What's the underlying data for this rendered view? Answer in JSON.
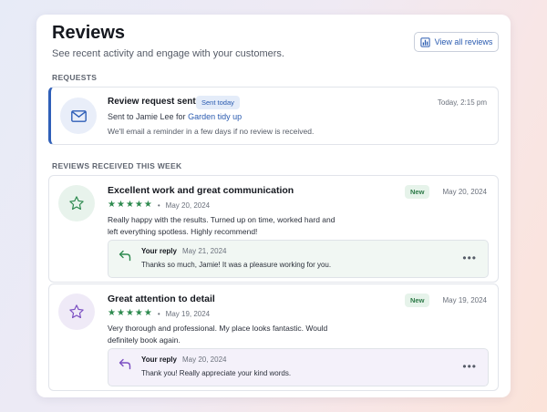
{
  "header": {
    "title": "Reviews",
    "subtitle": "See recent activity and engage with your customers.",
    "view_all_label": "View all reviews",
    "view_all_icon": "bar-chart-icon"
  },
  "requests": {
    "section_label": "REQUESTS",
    "item": {
      "icon": "mail-icon",
      "title": "Review request sent",
      "badge": "Sent today",
      "sent_to_prefix": "Sent to Jamie Lee for",
      "project_link": "Garden tidy up",
      "note": "We'll email a reminder in a few days if no review is received.",
      "time": "Today, 2:15 pm"
    }
  },
  "reviews": {
    "section_label": "REVIEWS RECEIVED THIS WEEK",
    "items": [
      {
        "icon": "star-outline-icon",
        "accent": "#2e8a4f",
        "title": "Excellent work and great communication",
        "rating": 5,
        "review_date": "May 20, 2024",
        "body": "Really happy with the results. Turned up on time, worked hard and left everything spotless. Highly recommend!",
        "badge": "New",
        "date": "May 20, 2024",
        "reply": {
          "label": "Your reply",
          "date": "May 21, 2024",
          "text": "Thanks so much, Jamie! It was a pleasure working for you."
        }
      },
      {
        "icon": "star-outline-icon",
        "accent": "#7b4fc2",
        "title": "Great attention to detail",
        "rating": 5,
        "review_date": "May 19, 2024",
        "body": "Very thorough and professional. My place looks fantastic. Would definitely book again.",
        "badge": "New",
        "date": "May 19, 2024",
        "reply": {
          "label": "Your reply",
          "date": "May 20, 2024",
          "text": "Thank you! Really appreciate your kind words."
        }
      }
    ]
  },
  "colors": {
    "primary": "#2f5fb8",
    "star": "#2e8a4f",
    "new_badge_bg": "#e6f3ea"
  }
}
